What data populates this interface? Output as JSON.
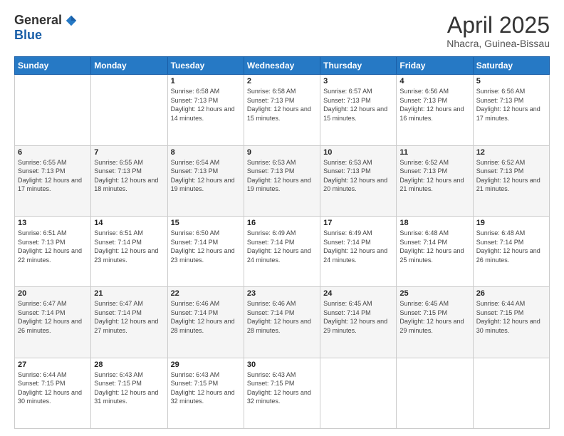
{
  "logo": {
    "general": "General",
    "blue": "Blue"
  },
  "title": {
    "month": "April 2025",
    "location": "Nhacra, Guinea-Bissau"
  },
  "headers": [
    "Sunday",
    "Monday",
    "Tuesday",
    "Wednesday",
    "Thursday",
    "Friday",
    "Saturday"
  ],
  "weeks": [
    [
      {
        "num": "",
        "info": ""
      },
      {
        "num": "",
        "info": ""
      },
      {
        "num": "1",
        "info": "Sunrise: 6:58 AM\nSunset: 7:13 PM\nDaylight: 12 hours and 14 minutes."
      },
      {
        "num": "2",
        "info": "Sunrise: 6:58 AM\nSunset: 7:13 PM\nDaylight: 12 hours and 15 minutes."
      },
      {
        "num": "3",
        "info": "Sunrise: 6:57 AM\nSunset: 7:13 PM\nDaylight: 12 hours and 15 minutes."
      },
      {
        "num": "4",
        "info": "Sunrise: 6:56 AM\nSunset: 7:13 PM\nDaylight: 12 hours and 16 minutes."
      },
      {
        "num": "5",
        "info": "Sunrise: 6:56 AM\nSunset: 7:13 PM\nDaylight: 12 hours and 17 minutes."
      }
    ],
    [
      {
        "num": "6",
        "info": "Sunrise: 6:55 AM\nSunset: 7:13 PM\nDaylight: 12 hours and 17 minutes."
      },
      {
        "num": "7",
        "info": "Sunrise: 6:55 AM\nSunset: 7:13 PM\nDaylight: 12 hours and 18 minutes."
      },
      {
        "num": "8",
        "info": "Sunrise: 6:54 AM\nSunset: 7:13 PM\nDaylight: 12 hours and 19 minutes."
      },
      {
        "num": "9",
        "info": "Sunrise: 6:53 AM\nSunset: 7:13 PM\nDaylight: 12 hours and 19 minutes."
      },
      {
        "num": "10",
        "info": "Sunrise: 6:53 AM\nSunset: 7:13 PM\nDaylight: 12 hours and 20 minutes."
      },
      {
        "num": "11",
        "info": "Sunrise: 6:52 AM\nSunset: 7:13 PM\nDaylight: 12 hours and 21 minutes."
      },
      {
        "num": "12",
        "info": "Sunrise: 6:52 AM\nSunset: 7:13 PM\nDaylight: 12 hours and 21 minutes."
      }
    ],
    [
      {
        "num": "13",
        "info": "Sunrise: 6:51 AM\nSunset: 7:13 PM\nDaylight: 12 hours and 22 minutes."
      },
      {
        "num": "14",
        "info": "Sunrise: 6:51 AM\nSunset: 7:14 PM\nDaylight: 12 hours and 23 minutes."
      },
      {
        "num": "15",
        "info": "Sunrise: 6:50 AM\nSunset: 7:14 PM\nDaylight: 12 hours and 23 minutes."
      },
      {
        "num": "16",
        "info": "Sunrise: 6:49 AM\nSunset: 7:14 PM\nDaylight: 12 hours and 24 minutes."
      },
      {
        "num": "17",
        "info": "Sunrise: 6:49 AM\nSunset: 7:14 PM\nDaylight: 12 hours and 24 minutes."
      },
      {
        "num": "18",
        "info": "Sunrise: 6:48 AM\nSunset: 7:14 PM\nDaylight: 12 hours and 25 minutes."
      },
      {
        "num": "19",
        "info": "Sunrise: 6:48 AM\nSunset: 7:14 PM\nDaylight: 12 hours and 26 minutes."
      }
    ],
    [
      {
        "num": "20",
        "info": "Sunrise: 6:47 AM\nSunset: 7:14 PM\nDaylight: 12 hours and 26 minutes."
      },
      {
        "num": "21",
        "info": "Sunrise: 6:47 AM\nSunset: 7:14 PM\nDaylight: 12 hours and 27 minutes."
      },
      {
        "num": "22",
        "info": "Sunrise: 6:46 AM\nSunset: 7:14 PM\nDaylight: 12 hours and 28 minutes."
      },
      {
        "num": "23",
        "info": "Sunrise: 6:46 AM\nSunset: 7:14 PM\nDaylight: 12 hours and 28 minutes."
      },
      {
        "num": "24",
        "info": "Sunrise: 6:45 AM\nSunset: 7:14 PM\nDaylight: 12 hours and 29 minutes."
      },
      {
        "num": "25",
        "info": "Sunrise: 6:45 AM\nSunset: 7:15 PM\nDaylight: 12 hours and 29 minutes."
      },
      {
        "num": "26",
        "info": "Sunrise: 6:44 AM\nSunset: 7:15 PM\nDaylight: 12 hours and 30 minutes."
      }
    ],
    [
      {
        "num": "27",
        "info": "Sunrise: 6:44 AM\nSunset: 7:15 PM\nDaylight: 12 hours and 30 minutes."
      },
      {
        "num": "28",
        "info": "Sunrise: 6:43 AM\nSunset: 7:15 PM\nDaylight: 12 hours and 31 minutes."
      },
      {
        "num": "29",
        "info": "Sunrise: 6:43 AM\nSunset: 7:15 PM\nDaylight: 12 hours and 32 minutes."
      },
      {
        "num": "30",
        "info": "Sunrise: 6:43 AM\nSunset: 7:15 PM\nDaylight: 12 hours and 32 minutes."
      },
      {
        "num": "",
        "info": ""
      },
      {
        "num": "",
        "info": ""
      },
      {
        "num": "",
        "info": ""
      }
    ]
  ]
}
